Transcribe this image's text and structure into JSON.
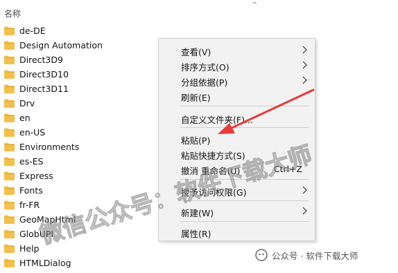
{
  "header": {
    "name_column": "名称",
    "sort_indicator": "^"
  },
  "files": [
    "de-DE",
    "Design Automation",
    "Direct3D9",
    "Direct3D10",
    "Direct3D11",
    "Drv",
    "en",
    "en-US",
    "Environments",
    "es-ES",
    "Express",
    "Fonts",
    "fr-FR",
    "GeoMapHtml",
    "GlobUPI",
    "Help",
    "HTMLDialog"
  ],
  "context_menu": {
    "items": [
      {
        "label": "查看(V)",
        "submenu": true
      },
      {
        "label": "排序方式(O)",
        "submenu": true
      },
      {
        "label": "分组依据(P)",
        "submenu": true
      },
      {
        "label": "刷新(E)",
        "submenu": false
      },
      {
        "label": "自定义文件夹(F)...",
        "submenu": false
      },
      {
        "label": "粘贴(P)",
        "submenu": false
      },
      {
        "label": "粘贴快捷方式(S)",
        "submenu": false
      },
      {
        "label": "撤消 重命名(U)",
        "submenu": false,
        "shortcut": "Ctrl+Z"
      },
      {
        "label": "授予访问权限(G)",
        "submenu": true
      },
      {
        "label": "新建(W)",
        "submenu": true
      },
      {
        "label": "属性(R)",
        "submenu": false
      }
    ]
  },
  "watermark": {
    "diagonal_text": "微信公众号：软件下载大师",
    "footer_text": "公众号 · 软件下载大师"
  },
  "colors": {
    "folder": "#f3c04b",
    "folder_dark": "#dba630",
    "menu_bg": "#f2f2f2",
    "arrow_red": "#e83a3a"
  }
}
